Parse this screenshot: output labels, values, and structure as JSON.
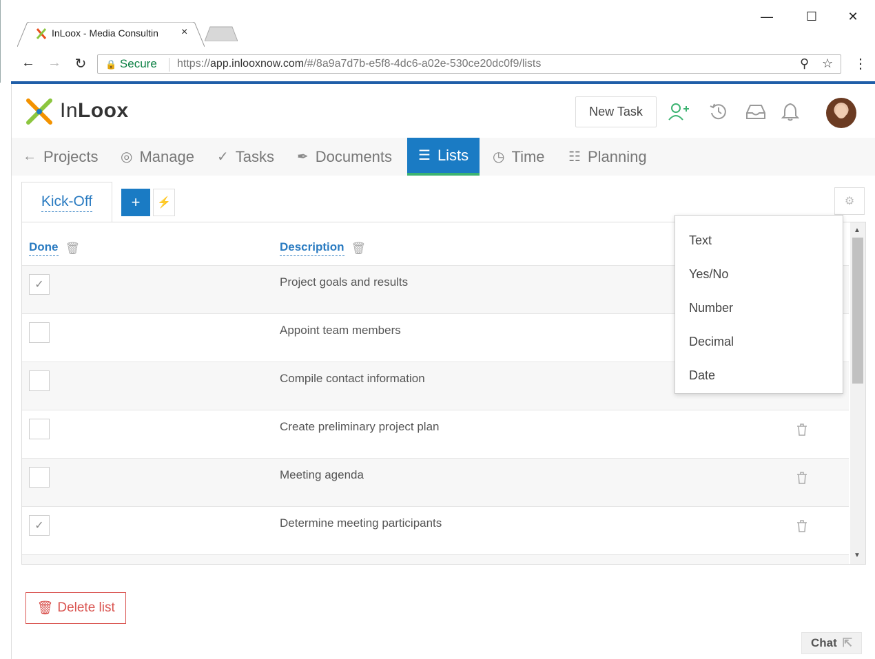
{
  "browser": {
    "tab_title": "InLoox - Media Consultin",
    "tab_close": "×",
    "secure_label": "Secure",
    "url_prefix": "https://",
    "url_host": "app.inlooxnow.com",
    "url_path": "/#/8a9a7d7b-e5f8-4dc6-a02e-530ce20dc0f9/lists",
    "icons": [
      "back-arrow-icon",
      "forward-arrow-icon",
      "reload-icon",
      "lock-icon",
      "zoom-icon",
      "star-icon",
      "more-icon",
      "minimize-icon",
      "maximize-icon",
      "close-icon"
    ]
  },
  "app": {
    "logo_text_light": "In",
    "logo_text_bold": "Loox",
    "new_task_label": "New Task",
    "nav": [
      {
        "label": "Projects",
        "icon": "arrow-left-icon",
        "glyph": "←"
      },
      {
        "label": "Manage",
        "icon": "target-icon",
        "glyph": "◎"
      },
      {
        "label": "Tasks",
        "icon": "check-icon",
        "glyph": "✓"
      },
      {
        "label": "Documents",
        "icon": "paperclip-icon",
        "glyph": "🖇"
      },
      {
        "label": "Lists",
        "icon": "list-icon",
        "glyph": "☰"
      },
      {
        "label": "Time",
        "icon": "clock-icon",
        "glyph": "◷"
      },
      {
        "label": "Planning",
        "icon": "checklist-icon",
        "glyph": "☷"
      }
    ],
    "active_nav": "Lists",
    "accent_color": "#1a7bc4",
    "active_underline_color": "#3cb371"
  },
  "list": {
    "tab_label": "Kick-Off",
    "add_label": "+",
    "columns": {
      "done": "Done",
      "description": "Description"
    },
    "rows": [
      {
        "done": true,
        "description": "Project goals and results"
      },
      {
        "done": false,
        "description": "Appoint team members"
      },
      {
        "done": false,
        "description": "Compile contact information"
      },
      {
        "done": false,
        "description": "Create preliminary project plan"
      },
      {
        "done": false,
        "description": "Meeting agenda"
      },
      {
        "done": true,
        "description": "Determine meeting participants"
      }
    ],
    "delete_label": "Delete list"
  },
  "dropdown": {
    "items": [
      "Text",
      "Yes/No",
      "Number",
      "Decimal",
      "Date"
    ]
  },
  "chat_label": "Chat"
}
